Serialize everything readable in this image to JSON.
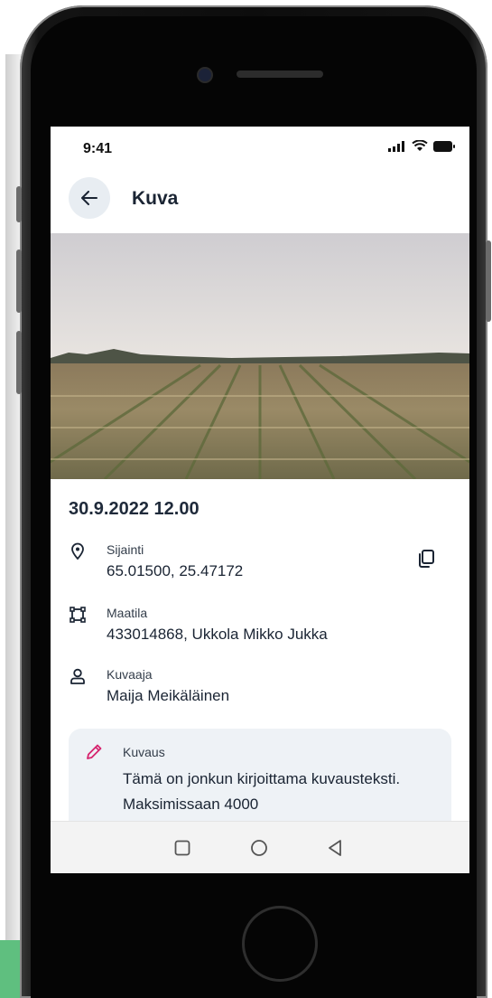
{
  "status_bar": {
    "time": "9:41"
  },
  "header": {
    "title": "Kuva"
  },
  "photo": {
    "alt": ""
  },
  "details": {
    "date": "30.9.2022 12.00",
    "location": {
      "label": "Sijainti",
      "value": "65.01500, 25.47172"
    },
    "farm": {
      "label": "Maatila",
      "value": "433014868, Ukkola Mikko Jukka"
    },
    "photographer": {
      "label": "Kuvaaja",
      "value": "Maija Meikäläinen"
    }
  },
  "description": {
    "label": "Kuvaus",
    "text": "Tämä on jonkun kirjoittama kuvausteksti. Maksimissaan 4000"
  },
  "colors": {
    "accent_pink": "#d6246e",
    "primary_text": "#1a2433",
    "card_bg": "#eef2f6"
  },
  "icons": [
    "back-arrow-icon",
    "location-pin-icon",
    "copy-icon",
    "farm-area-icon",
    "person-icon",
    "pencil-icon",
    "nav-square-icon",
    "nav-circle-icon",
    "nav-back-triangle-icon",
    "signal-icon",
    "wifi-icon",
    "battery-icon"
  ]
}
